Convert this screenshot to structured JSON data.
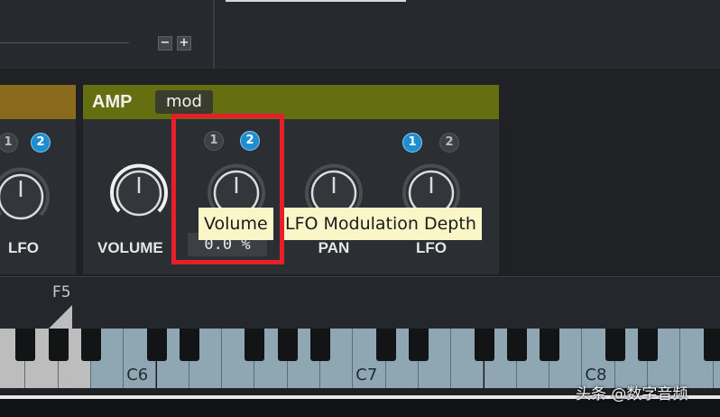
{
  "amp_panel": {
    "title": "AMP",
    "mod_badge": "mod",
    "value_display": "0.0 %"
  },
  "left_panel": {
    "slots": [
      "1",
      "2"
    ],
    "knob_label": "LFO"
  },
  "knobs": [
    {
      "label": "VOLUME",
      "slots": []
    },
    {
      "label": "",
      "slots": [
        "1",
        "2"
      ],
      "active_slot": "2"
    },
    {
      "label": "PAN",
      "slots": []
    },
    {
      "label": "LFO",
      "slots": [
        "1",
        "2"
      ],
      "active_slot": "1"
    }
  ],
  "tooltips": {
    "volume": "Volume",
    "lfo_depth": "LFO Modulation Depth"
  },
  "top": {
    "minus_label": "−",
    "plus_label": "+"
  },
  "keyboard": {
    "range_label": "F5",
    "octave_labels": [
      "C6",
      "C7",
      "C8"
    ]
  },
  "watermark": "头条 @数字音频",
  "colors": {
    "amp_header": "#656f10",
    "left_header": "#8a6a1c",
    "active_slot": "#1e8ed0",
    "highlight": "#e5202a",
    "tooltip_bg": "#fbf6c8",
    "key_active": "#8fa7b3",
    "key_inactive": "#bdbdbd"
  },
  "icons": {
    "minus": "minus-icon",
    "plus": "plus-icon",
    "range_marker": "range-marker-icon"
  }
}
